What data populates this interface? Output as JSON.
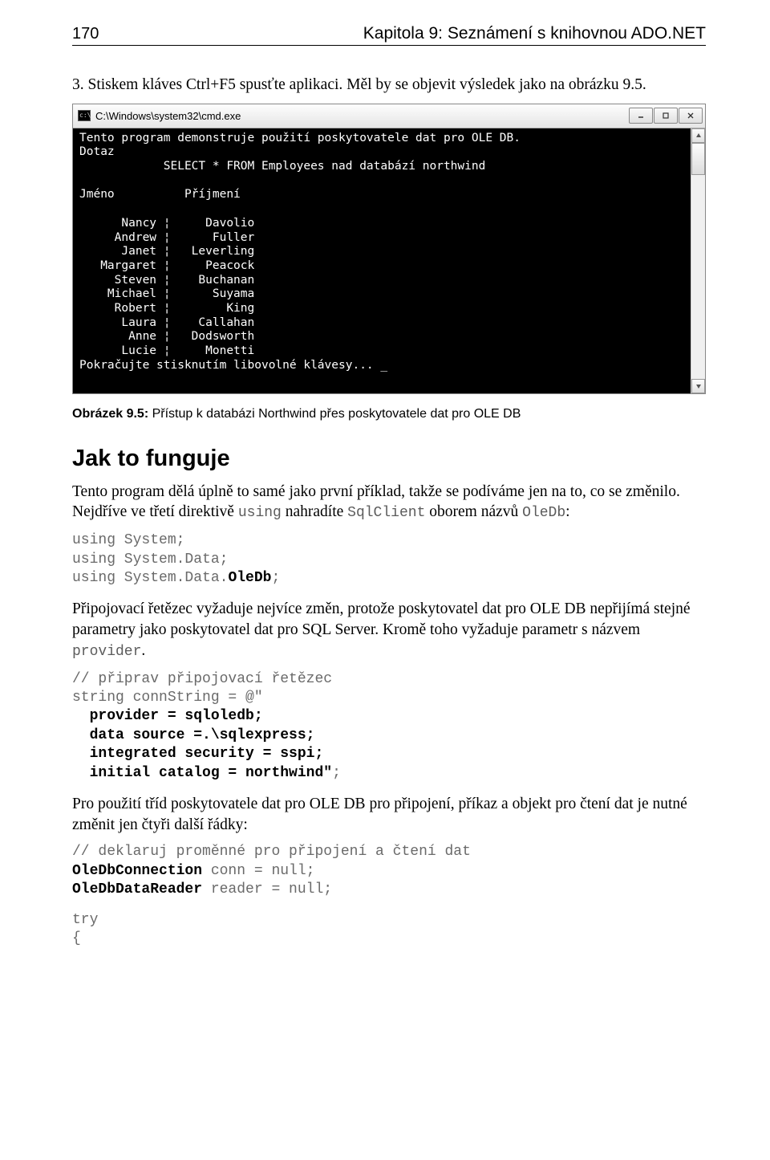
{
  "header": {
    "page_number": "170",
    "chapter": "Kapitola 9: Seznámení s knihovnou ADO.NET"
  },
  "intro_step": "3.   Stiskem kláves Ctrl+F5 spusťte aplikaci. Měl by se objevit výsledek jako na obrázku 9.5.",
  "cmd": {
    "title": "C:\\Windows\\system32\\cmd.exe",
    "lines": [
      "Tento program demonstruje použití poskytovatele dat pro OLE DB.",
      "Dotaz",
      "            SELECT * FROM Employees nad databází northwind",
      "",
      "Jméno          Příjmení",
      "",
      "      Nancy ¦     Davolio",
      "     Andrew ¦      Fuller",
      "      Janet ¦   Leverling",
      "   Margaret ¦     Peacock",
      "     Steven ¦    Buchanan",
      "    Michael ¦      Suyama",
      "     Robert ¦        King",
      "      Laura ¦    Callahan",
      "       Anne ¦   Dodsworth",
      "      Lucie ¦     Monetti",
      "Pokračujte stisknutím libovolné klávesy... _"
    ]
  },
  "caption": {
    "label": "Obrázek 9.5:",
    "text": " Přístup k databázi Northwind přes poskytovatele dat pro OLE DB"
  },
  "section": "Jak to funguje",
  "para1": "Tento program dělá úplně to samé jako první příklad, takže se podíváme jen na to, co se změnilo. Nejdříve ve třetí direktivě ",
  "para1_code1": "using",
  "para1_mid": " nahradíte ",
  "para1_code2": "SqlClient",
  "para1_mid2": " oborem názvů ",
  "para1_code3": "OleDb",
  "para1_end": ":",
  "code_block1": "using System;\nusing System.Data;\nusing System.Data.<strong>OleDb</strong>;",
  "para2_a": "Připojovací řetězec vyžaduje nejvíce změn, protože poskytovatel dat pro OLE DB nepřijímá stejné parametry jako poskytovatel dat pro SQL Server. Kromě toho vyžaduje parametr s názvem ",
  "para2_code": "provider",
  "para2_b": ".",
  "code_block2_lines": [
    {
      "t": "// připrav připojovací řetězec",
      "s": false
    },
    {
      "t": "string connString = @\"",
      "s": false
    },
    {
      "t": "  provider = sqloledb;",
      "s": true
    },
    {
      "t": "  data source =.\\sqlexpress;",
      "s": true
    },
    {
      "t": "  integrated security = sspi;",
      "s": true
    },
    {
      "t": "  initial catalog = northwind\"",
      "s": true,
      "suffix": ";"
    }
  ],
  "para3": "Pro použití tříd poskytovatele dat pro OLE DB pro připojení, příkaz a objekt pro čtení dat je nutné změnit jen čtyři další řádky:",
  "code_block3_lines": [
    {
      "t": "// deklaruj proměnné pro připojení a čtení dat",
      "s": false
    },
    {
      "pre": "",
      "strong": "OleDbConnection",
      "post": " conn = null;"
    },
    {
      "pre": "",
      "strong": "OleDbDataReader",
      "post": " reader = null;"
    }
  ],
  "code_block4": "try\n{"
}
